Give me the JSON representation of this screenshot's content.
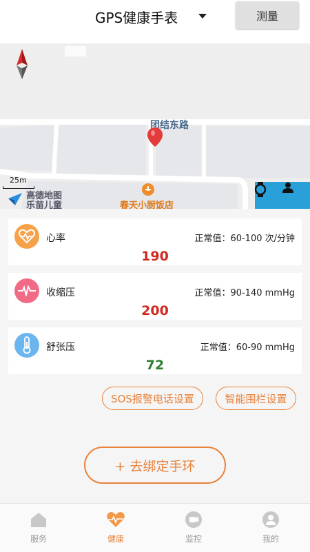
{
  "header": {
    "title": "GPS健康手表",
    "measure_label": "测量"
  },
  "map": {
    "street_label": "团结东路",
    "poi_label": "春天小厨饭店",
    "scale_label": "25m",
    "logo_text": "高德地图",
    "logo_sub_text": "乐苗儿童",
    "tools": [
      "watch-icon",
      "person-icon"
    ]
  },
  "metrics": [
    {
      "label": "心率",
      "range": "正常值：60-100 次/分钟",
      "value": "190",
      "value_color": "#d0281e",
      "icon": "heart-rate-icon",
      "icon_color": "#f7a14a"
    },
    {
      "label": "收缩压",
      "range": "正常值：90-140 mmHg",
      "value": "200",
      "value_color": "#d0281e",
      "icon": "pulse-icon",
      "icon_color": "#f26b86"
    },
    {
      "label": "舒张压",
      "range": "正常值：60-90 mmHg",
      "value": "72",
      "value_color": "#2e7d32",
      "icon": "thermometer-icon",
      "icon_color": "#6cb6ef"
    }
  ],
  "actions": {
    "sos_label": "SOS报警电话设置",
    "fence_label": "智能围栏设置",
    "bind_label": "+ 去绑定手环"
  },
  "nav": {
    "items": [
      {
        "label": "服务",
        "icon": "home-icon",
        "active": false
      },
      {
        "label": "健康",
        "icon": "heart-icon",
        "active": true
      },
      {
        "label": "监控",
        "icon": "camera-icon",
        "active": false
      },
      {
        "label": "我的",
        "icon": "user-icon",
        "active": false
      }
    ]
  },
  "colors": {
    "accent": "#e8813a",
    "map_tool_bg": "#2aa0d8"
  }
}
